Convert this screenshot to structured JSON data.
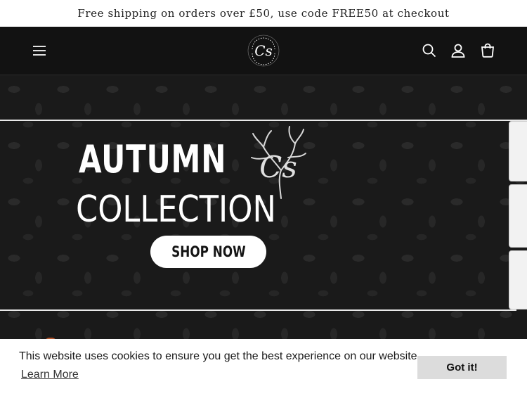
{
  "announcement": {
    "text": "Free shipping on orders over £50, use code FREE50 at checkout"
  },
  "header": {
    "menu_icon": "hamburger-menu-icon",
    "logo_icon": "cs-logo-icon",
    "logo_ring_text": "CORNISH SCENTED COMPANY",
    "search_icon": "search-icon",
    "account_icon": "user-icon",
    "cart_icon": "cart-icon"
  },
  "hero": {
    "title_line1": "AUTUMN",
    "title_line2": "COLLECTION",
    "logo_letters": "Cs",
    "cta_label": "SHOP NOW"
  },
  "cookie_banner": {
    "message": "This website uses cookies to ensure you get the best experience on our website.",
    "learn_more": "Learn More",
    "accept_label": "Got it!"
  },
  "colors": {
    "header_bg": "#121212",
    "hero_bg": "#1a1a1a",
    "accent": "#ffffff",
    "cookie_btn": "#dcdcdc"
  }
}
